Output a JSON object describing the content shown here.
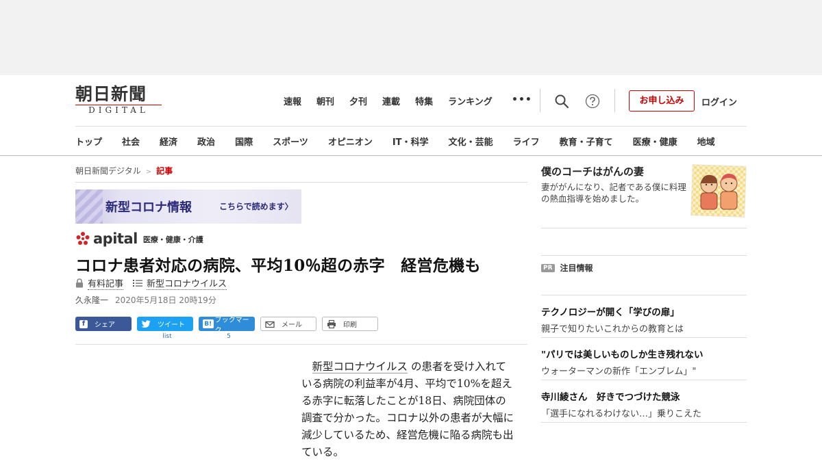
{
  "logo": {
    "title": "朝日新聞",
    "subtitle": "DIGITAL"
  },
  "topnav": [
    "速報",
    "朝刊",
    "夕刊",
    "連載",
    "特集",
    "ランキング"
  ],
  "header": {
    "more_label": "•••",
    "subscribe_label": "お申し込み",
    "login_label": "ログイン"
  },
  "categories": [
    "トップ",
    "社会",
    "経済",
    "政治",
    "国際",
    "スポーツ",
    "オピニオン",
    "IT・科学",
    "文化・芸能",
    "ライフ",
    "教育・子育て",
    "医療・健康",
    "地域"
  ],
  "breadcrumb": {
    "home": "朝日新聞デジタル",
    "sep": ">",
    "current": "記事"
  },
  "covid_banner": {
    "title": "新型コロナ情報",
    "cta": "こちらで読めます〉"
  },
  "apital": {
    "name": "apital",
    "section": "医療・健康・介護"
  },
  "article": {
    "headline": "コロナ患者対応の病院、平均10％超の赤字　経営危機も",
    "paid_label": "有料記事",
    "topic_label": "新型コロナウイルス",
    "author": "久永隆一",
    "date": "2020年5月18日 20時19分",
    "body_indent": "　",
    "body_link": "新型コロナウイルス",
    "body_rest": "の患者を受け入れている病院の利益率が4月、平均で10%を超える赤字に転落したことが18日、病院団体の調査で分かった。コロナ以外の患者が大幅に減少しているため、経営危機に陥る病院も出ている。"
  },
  "share": {
    "facebook": "シェア",
    "twitter": "ツイート",
    "hatena": "ブックマーク",
    "hatena_icon": "B!",
    "mail": "メール",
    "print": "印刷",
    "twitter_count": "list",
    "hatena_count": "5"
  },
  "sidebar": {
    "feature": {
      "title": "僕のコーチはがんの妻",
      "desc": "妻ががんになり、記者である僕に料理の熱血指導を始めました。"
    },
    "pr": {
      "badge": "PR",
      "label": "注目情報"
    },
    "items": [
      {
        "title": "テクノロジーが開く「学びの扉」",
        "desc": "親子で知りたいこれからの教育とは"
      },
      {
        "title": "\"パリでは美しいものしか生き残れない",
        "desc": "ウォーターマンの新作「エンブレム」\""
      },
      {
        "title": "寺川綾さん　好きでつづけた競泳",
        "desc": "「選手になれるわけない…」乗りこえた"
      }
    ]
  },
  "colors": {
    "accent": "#cc0000",
    "facebook": "#3b5998",
    "twitter": "#1da1f2",
    "hatena": "#2e8cd8",
    "banner_text": "#2b2a7a"
  }
}
